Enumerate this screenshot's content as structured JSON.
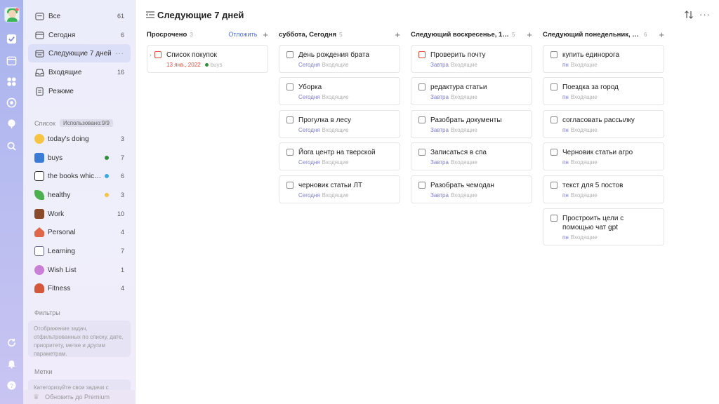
{
  "sidebar": {
    "nav": [
      {
        "label": "Все",
        "count": "61",
        "icon": "inbox-all-icon"
      },
      {
        "label": "Сегодня",
        "count": "6",
        "icon": "calendar-today-icon"
      },
      {
        "label": "Следующие 7 дней",
        "count": "···",
        "icon": "calendar-week-icon"
      },
      {
        "label": "Входящие",
        "count": "16",
        "icon": "inbox-icon"
      },
      {
        "label": "Резюме",
        "count": "",
        "icon": "summary-icon"
      }
    ],
    "lists_header": "Список",
    "lists_badge": "Использовано:9/9",
    "lists": [
      {
        "label": "today's doing",
        "count": "3",
        "dot": "",
        "emoji_color": "#f6c343"
      },
      {
        "label": "buys",
        "count": "7",
        "dot": "#2f8f3a",
        "emoji_color": "#3a7bd5"
      },
      {
        "label": "the books which I ...",
        "count": "6",
        "dot": "#39a7e0",
        "emoji_color": "#8a5a2b"
      },
      {
        "label": "healthy",
        "count": "3",
        "dot": "#f6c343",
        "emoji_color": "#4caf50"
      },
      {
        "label": "Work",
        "count": "10",
        "dot": "",
        "emoji_color": "#8b4b2a"
      },
      {
        "label": "Personal",
        "count": "4",
        "dot": "",
        "emoji_color": "#e0674a"
      },
      {
        "label": "Learning",
        "count": "7",
        "dot": "",
        "emoji_color": "#6a6a8a"
      },
      {
        "label": "Wish List",
        "count": "1",
        "dot": "",
        "emoji_color": "#c97fd6"
      },
      {
        "label": "Fitness",
        "count": "4",
        "dot": "",
        "emoji_color": "#d4573b"
      }
    ],
    "filters_header": "Фильтры",
    "filters_hint": "Отображение задач, отфильтрованных по списку, дате, приоритету, метке и другим параметрам.",
    "tags_header": "Метки",
    "tags_hint": "Категоризуйте свои задачи с",
    "premium": "Обновить до Premium"
  },
  "main": {
    "title": "Следующие 7 дней",
    "columns": [
      {
        "title": "Просрочено",
        "count": "3",
        "action": "Отложить",
        "tasks": [
          {
            "title": "Список покупок",
            "due": "13 янв., 2022",
            "due_red": true,
            "list": "buys",
            "list_dot": "#2f8f3a",
            "red": true,
            "expand": true
          }
        ]
      },
      {
        "title": "суббота, Сегодня",
        "count": "5",
        "action": "",
        "tasks": [
          {
            "title": "День рождения брата",
            "due": "Сегодня",
            "list": "Входящие"
          },
          {
            "title": "Уборка",
            "due": "Сегодня",
            "list": "Входящие"
          },
          {
            "title": "Прогулка в лесу",
            "due": "Сегодня",
            "list": "Входящие"
          },
          {
            "title": "Йога центр на тверской",
            "due": "Сегодня",
            "list": "Входящие"
          },
          {
            "title": "черновик статьи ЛТ",
            "due": "Сегодня",
            "list": "Входящие"
          }
        ]
      },
      {
        "title": "Следующий воскресенье, 19 ян...",
        "count": "5",
        "action": "",
        "tasks": [
          {
            "title": "Проверить почту",
            "due": "Завтра",
            "list": "Входящие",
            "red": true
          },
          {
            "title": "редактура статьи",
            "due": "Завтра",
            "list": "Входящие"
          },
          {
            "title": "Разобрать документы",
            "due": "Завтра",
            "list": "Входящие"
          },
          {
            "title": "Записаться в спа",
            "due": "Завтра",
            "list": "Входящие"
          },
          {
            "title": "Разобрать чемодан",
            "due": "Завтра",
            "list": "Входящие"
          }
        ]
      },
      {
        "title": "Следующий понедельник, 20 я...",
        "count": "6",
        "action": "",
        "tasks": [
          {
            "title": "купить единорога",
            "due": "пн",
            "list": "Входящие"
          },
          {
            "title": "Поездка за город",
            "due": "пн",
            "list": "Входящие"
          },
          {
            "title": "согласовать рассылку",
            "due": "пн",
            "list": "Входящие"
          },
          {
            "title": "Черновик статьи агро",
            "due": "пн",
            "list": "Входящие"
          },
          {
            "title": "текст для 5 постов",
            "due": "пн",
            "list": "Входящие"
          },
          {
            "title": "Простроить цели с помощью чат  gpt",
            "due": "пн",
            "list": "Входящие"
          }
        ]
      }
    ]
  }
}
